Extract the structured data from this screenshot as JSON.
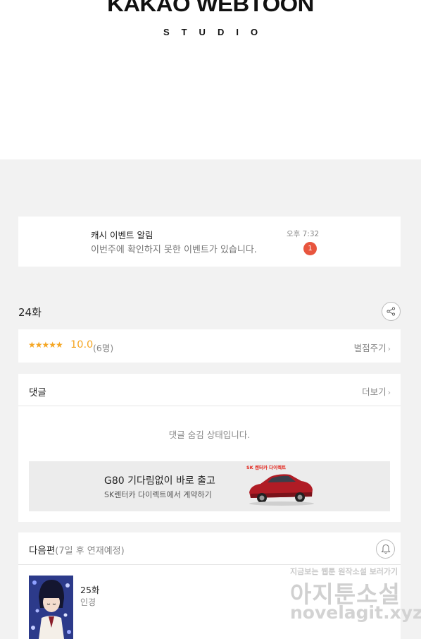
{
  "header": {
    "logo_main": "KAKAO WEBTOON",
    "logo_sub": "STUDIO"
  },
  "notice": {
    "title": "캐시 이벤트 알림",
    "message": "이번주에 확인하지 못한 이벤트가 있습니다.",
    "time": "오후 7:32",
    "badge_count": "1"
  },
  "episode": {
    "title": "24화",
    "share_icon": "share-icon"
  },
  "rating": {
    "stars": "★★★★★",
    "score": "10.0",
    "count": "(6명)",
    "rate_label": "별점주기"
  },
  "comments": {
    "title": "댓글",
    "more_label": "더보기",
    "hidden_message": "댓글 숨김 상태입니다."
  },
  "ad": {
    "title": "G80 기다림없이 바로 출고",
    "subtitle": "SK렌터카 다이렉트에서 계약하기",
    "brand": "SK 렌터카 다이렉트"
  },
  "next_episode": {
    "title": "다음편",
    "schedule": "(7일 후 연재예정)",
    "episode_number": "25화",
    "episode_name": "인경",
    "bell_icon": "bell-icon"
  },
  "watermark": {
    "top_line": "지금보는 웹툰 원작소설 보러가기",
    "main": "아지툰소설",
    "url": "novelagit.xyz"
  },
  "colors": {
    "accent_star": "#f5a623",
    "badge": "#e8553e",
    "background": "#f2f2f2"
  }
}
